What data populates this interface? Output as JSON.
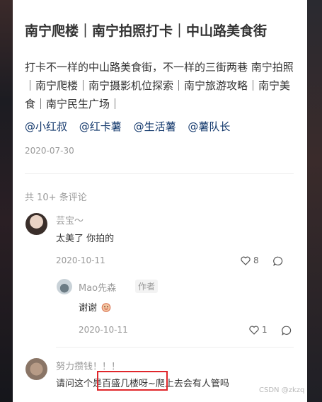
{
  "post": {
    "title": "南宁爬楼｜南宁拍照打卡｜中山路美食街",
    "description": "打卡不一样的中山路美食街，不一样的三街两巷 南宁拍照｜南宁爬楼｜南宁摄影机位探索｜南宁旅游攻略｜南宁美食｜南宁民生广场｜",
    "tags": [
      "@小红叔",
      "@红卡薯",
      "@生活薯",
      "@薯队长"
    ],
    "date": "2020-07-30"
  },
  "comments": {
    "count_label": "共 10+ 条评论",
    "items": [
      {
        "name": "芸宝～",
        "text": "太美了 你拍的",
        "date": "2020-10-11",
        "likes": "8"
      },
      {
        "name": "Mao先森",
        "badge": "作者",
        "text": "谢谢",
        "date": "2020-10-11",
        "likes": "1"
      },
      {
        "name": "努力攒钱！！！",
        "text": "请问这个是百盛几楼呀~爬上去会有人管吗"
      }
    ]
  },
  "watermark": "CSDN @zkzq",
  "colors": {
    "tag": "#13386c",
    "highlight": "#e0262b"
  }
}
